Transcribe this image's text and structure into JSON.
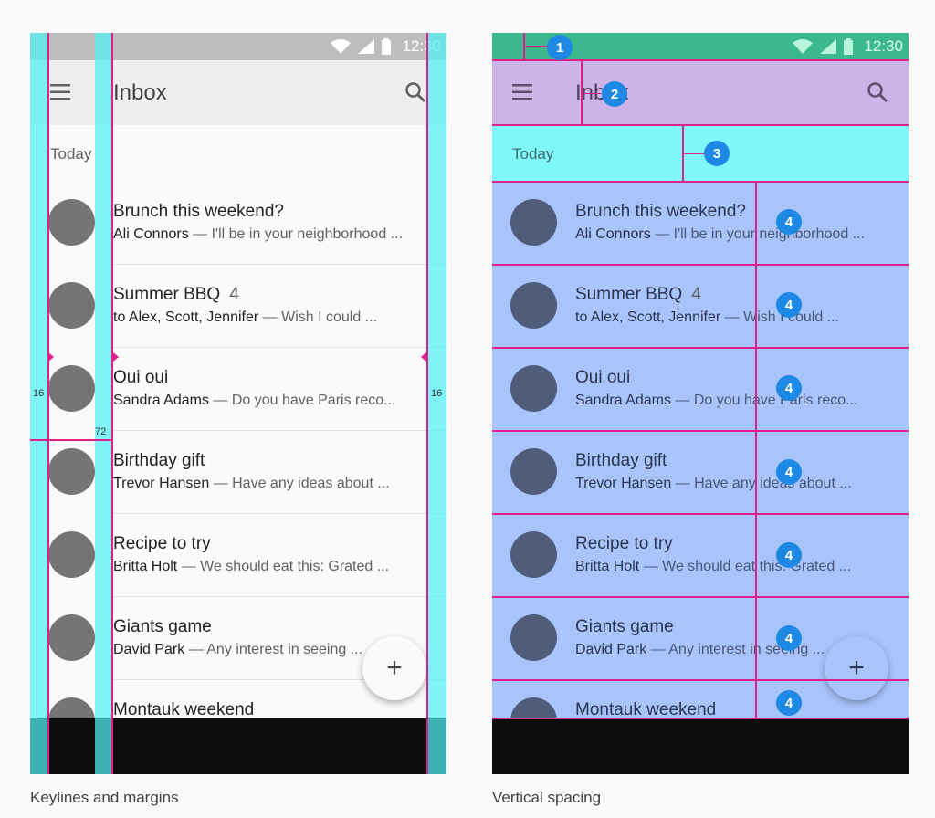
{
  "status_bar": {
    "time": "12:30"
  },
  "app_bar": {
    "title": "Inbox"
  },
  "subheader": "Today",
  "emails": [
    {
      "title": "Brunch this weekend?",
      "count": "",
      "sender": "Ali Connors",
      "snippet": " — I'll be in your neighborhood ..."
    },
    {
      "title": "Summer BBQ",
      "count": "4",
      "sender": "to Alex, Scott, Jennifer",
      "snippet": " — Wish I could ..."
    },
    {
      "title": "Oui oui",
      "count": "",
      "sender": "Sandra Adams",
      "snippet": " — Do you have Paris reco..."
    },
    {
      "title": "Birthday gift",
      "count": "",
      "sender": "Trevor Hansen",
      "snippet": " — Have any ideas about ..."
    },
    {
      "title": "Recipe to try",
      "count": "",
      "sender": "Britta Holt",
      "snippet": " — We should eat this: Grated ..."
    },
    {
      "title": "Giants game",
      "count": "",
      "sender": "David Park",
      "snippet": " — Any interest in seeing ..."
    },
    {
      "title": "Montauk weekend",
      "count": "",
      "sender": "",
      "snippet": ""
    }
  ],
  "fab": {
    "icon": "plus-icon",
    "symbol": "+"
  },
  "left_panel": {
    "caption": "Keylines and margins",
    "labels": {
      "margin_left": "16",
      "keyline": "72",
      "margin_right": "16"
    }
  },
  "right_panel": {
    "caption": "Vertical spacing",
    "badges": [
      "1",
      "2",
      "3",
      "4",
      "4",
      "4",
      "4",
      "4",
      "4",
      "4"
    ]
  },
  "colors": {
    "margin_cyan": "#50f0f5",
    "magenta_line": "#e0208a",
    "statusbar_tint": "#3cb88f",
    "appbar_tint": "#cdb4e8",
    "subheader_tint": "#7ff8fa",
    "list_tint": "#a8c4fb",
    "badge_blue": "#1e88e5"
  }
}
